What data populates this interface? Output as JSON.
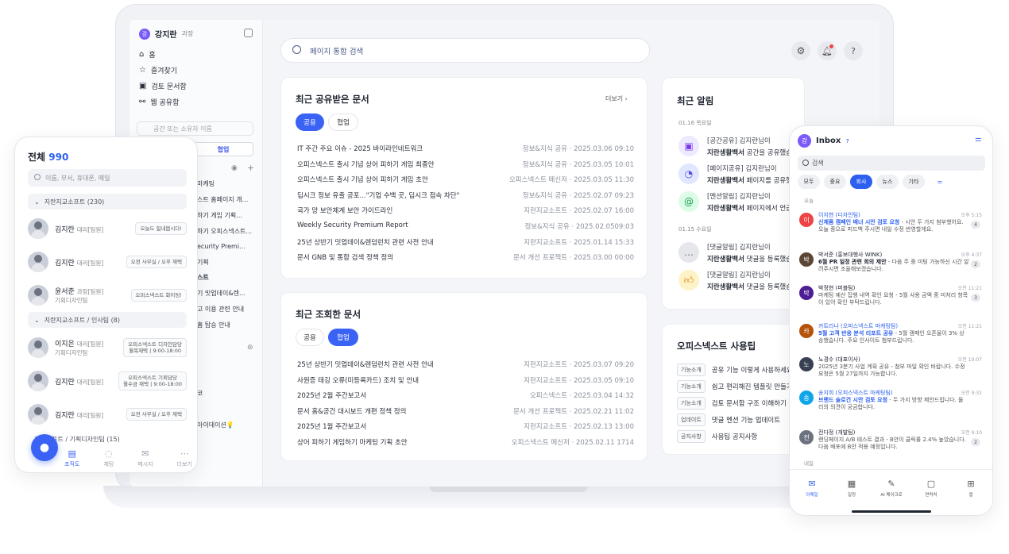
{
  "sidebar": {
    "user_name": "강지란",
    "user_role": "과장",
    "avatar_letter": "강",
    "menu": [
      "홈",
      "즐겨찾기",
      "검토 문서함",
      "웹 공유함"
    ],
    "search_placeholder": "공간 또는 소유자 이름",
    "tab": "협업",
    "rows": [
      "마케팅",
      "스트 홈페이지 개...",
      "하기 게임 기획...",
      "하기 오피스넥스트...",
      "ecurity Premi...",
      "기획",
      "스트",
      "기 밋업데이&렌...",
      "고 이용 관련 안내",
      "홈 탑승 안내",
      "코",
      "아이데이션💡"
    ]
  },
  "topbar": {
    "search_label": "페이지 통합 검색"
  },
  "shared_docs": {
    "title": "최근 공유받은 문서",
    "more": "더보기",
    "tabs": [
      "공용",
      "협업"
    ],
    "rows": [
      {
        "title": "IT 주간 주요 이슈 - 2025 바이라인네트워크",
        "meta": "정보&지식 공유 · 2025.03.06 09:10"
      },
      {
        "title": "오피스넥스트 출시 기념 상어 피하기 게임 최종안",
        "meta": "정보&지식 공유 · 2025.03.05 10:01"
      },
      {
        "title": "오피스넥스트 출시 기념 상어 피하기 게임 초안",
        "meta": "오피스넥스트 메신저 · 2025.03.05 11:30"
      },
      {
        "title": "딥시크 정보 유출 공포...\"기업 수백 곳, 딥시크 접속 차단\"",
        "meta": "정보&지식 공유 · 2025.02.07 09:23"
      },
      {
        "title": "국가 망 보안체계 보안 가이드라인",
        "meta": "지란지교소프트 · 2025.02.07 16:00"
      },
      {
        "title": "Weekly Security Premium Report",
        "meta": "정보&지식 공유 · 2025.02.0509:03"
      },
      {
        "title": "25년 상반기 밋업데이&렌덤런치 관련 사전 안내",
        "meta": "지란지교소프트 · 2025.01.14 15:33"
      },
      {
        "title": "문서 GNB 및 통합 검색 정책 정의",
        "meta": "문서 개선 프로젝트 · 2025.03.00 00:00"
      }
    ]
  },
  "recent_docs": {
    "title": "최근 조회한 문서",
    "tabs": [
      "공용",
      "협업"
    ],
    "rows": [
      {
        "title": "25년 상반기 밋업데이&렌덤런치 관련 사전 안내",
        "meta": "지란지교소프트 · 2025.03.07 09:20"
      },
      {
        "title": "사원증 태깅 오류(미등록카드) 조치 및 안내",
        "meta": "지란지교소프트 · 2025.03.05 09:10"
      },
      {
        "title": "2025년 2월 주간보고서",
        "meta": "오피스넥스트 · 2025.03.04 14:32"
      },
      {
        "title": "문서 홈&공간 대시보드 개편 정책 정의",
        "meta": "문서 개선 프로젝트 · 2025.02.21 11:02"
      },
      {
        "title": "2025년 1월 주간보고서",
        "meta": "지란지교소프트 · 2025.02.13 13:00"
      },
      {
        "title": "상어 피하기 게임하기 마케팅 기획 초안",
        "meta": "오피스넥스트 메신저 · 2025.02.11 1714"
      }
    ]
  },
  "alerts": {
    "title": "최근 알림",
    "date1": "01.16 목요일",
    "date2": "01.15 수요일",
    "items": [
      {
        "line1": "[공간공유] 김지란님이",
        "line2_bold": "지란생활백서",
        "line2": " 공간을 공유했습"
      },
      {
        "line1": "[페이지공유] 김지란님이",
        "line2_bold": "지란생활백서",
        "line2": " 페이지를 공유했"
      },
      {
        "line1": "[멘션알림] 김지란님이",
        "line2_bold": "지란생활백서",
        "line2": " 페이지에서 언급"
      },
      {
        "line1": "[댓글알림] 김지란님이",
        "line2_bold": "지란생활백서",
        "line2": " 댓글을 등록했습"
      },
      {
        "line1": "[댓글알림] 김지란님이",
        "line2_bold": "지란생활백서",
        "line2": " 댓글을 등록했습"
      }
    ]
  },
  "usage": {
    "title": "오피스넥스트 사용팁",
    "rows": [
      {
        "tag": "기능소개",
        "text": "공유 기능 이렇게 사용하세요"
      },
      {
        "tag": "기능소개",
        "text": "쉽고 편리해진 템플릿 만들기"
      },
      {
        "tag": "기능소개",
        "text": "검토 문서함 구조 이해하기"
      },
      {
        "tag": "업데이트",
        "text": "댓글 멘션 기능 업데이트"
      },
      {
        "tag": "공지사항",
        "text": "사용팁 공지사항"
      }
    ]
  },
  "org_phone": {
    "title": "전체",
    "count": "990",
    "search_placeholder": "이름, 부서, 휴대폰, 메일",
    "section1": "지란지교소프트 (230)",
    "section2": "지란지교소프트 / 인사팀 (8)",
    "section3": "지교소프트 / 기획디자인팀 (15)",
    "people": [
      {
        "name": "김지란",
        "role": "대리[팀원]",
        "sub": "",
        "badge": "오늘도 힘내봅시다!"
      },
      {
        "name": "김지란",
        "role": "대리[팀원]",
        "sub": "",
        "badge": "오전 사무실 / 오후 재택"
      },
      {
        "name": "윤서준",
        "role": "과장[팀원]",
        "sub": "기획디자인팀",
        "badge": "오피스넥스트 화이팅!"
      },
      {
        "name": "이지은",
        "role": "대리[팀원]",
        "sub": "기획디자인팀",
        "badge": "오피스넥스트 디자인담당\n월목재택 | 9:00-18:00"
      },
      {
        "name": "김지란",
        "role": "대리[팀원]",
        "sub": "",
        "badge": "오피스넥스트 기획담당\n월수금 재택 | 9:00-18:00"
      },
      {
        "name": "김지란",
        "role": "대리[팀원]",
        "sub": "",
        "badge": "오전 사무실 / 오후 재택"
      }
    ],
    "nav": [
      "조직도",
      "채팅",
      "메시지",
      "더보기"
    ]
  },
  "inbox_phone": {
    "title": "Inbox",
    "count": "7",
    "avatar_letter": "강",
    "search_placeholder": "검색",
    "chips": [
      "모두",
      "중요",
      "회사",
      "뉴스",
      "기타"
    ],
    "today": "오늘",
    "tomorrow": "내일",
    "mails": [
      {
        "letter": "이",
        "color": "#ef4444",
        "sender": "이지현 (디자인팀)",
        "time": "오후 5:15",
        "subject": "신제품 캠페인 배너 시안 검토 요청",
        "body": " - 시안 두 가지 첨부했어요. 오늘 중으로 피드백 주시면 내일 수정 반영할게요.",
        "count": "4"
      },
      {
        "letter": "박",
        "color": "#5b4636",
        "sender": "박서준 (홍보대행사 WINK)",
        "time": "오후 4:37",
        "subject": "6월 PR 일정 관련 회의 제안",
        "body": " - 다음 주 중 미팅 가능하신 시간 알려주시면 조율해보겠습니다.",
        "count": "2"
      },
      {
        "letter": "박",
        "color": "#4c1d95",
        "sender": "박정현 (퍼블팀)",
        "time": "오전 11:21",
        "subject": "",
        "body": "마케팅 예산 집행 내역 확인 요청 - 5월 사용 금액 중 미처리 항목이 있어 확인 부탁드립니다.",
        "count": "3"
      },
      {
        "letter": "카",
        "color": "#b45309",
        "sender": "카트리나 (오피스넥스트 마케팅팀)",
        "time": "오전 11:21",
        "subject": "5월 고객 반응 분석 리포트 공유",
        "body": " - 5월 캠페인 오픈율이 3% 상승했습니다. 주요 인사이트 첨부드립니다.",
        "count": ""
      },
      {
        "letter": "노",
        "color": "#374151",
        "sender": "노경수 (대표이사)",
        "time": "오전 10:07",
        "subject": "",
        "body": "2025년 3분기 사업 계획 공유 - 첨부 파일 확인 바랍니다. 수정 요청은 5월 27일까지 가능합니다.",
        "count": ""
      },
      {
        "letter": "송",
        "color": "#0ea5e9",
        "sender": "송지희 (오피스넥스트 마케팅팀)",
        "time": "오전 9:31",
        "subject": "브랜드 슬로건 시안 검토 요청",
        "body": " - 두 가지 방향 제안드립니다. 둘 리의 의견이 궁금합니다.",
        "count": ""
      },
      {
        "letter": "전",
        "color": "#6b7280",
        "sender": "전다정 (개발팀)",
        "time": "오전 9:10",
        "subject": "",
        "body": "랜딩페이지 A/B 테스트 결과 - B안이 클릭률 2.4% 높았습니다. 다음 배포에 B안 적용 예정입니다.",
        "count": "2"
      }
    ],
    "nav": [
      "이메일",
      "일정",
      "AI 페이크로",
      "연락처",
      "앱"
    ]
  }
}
